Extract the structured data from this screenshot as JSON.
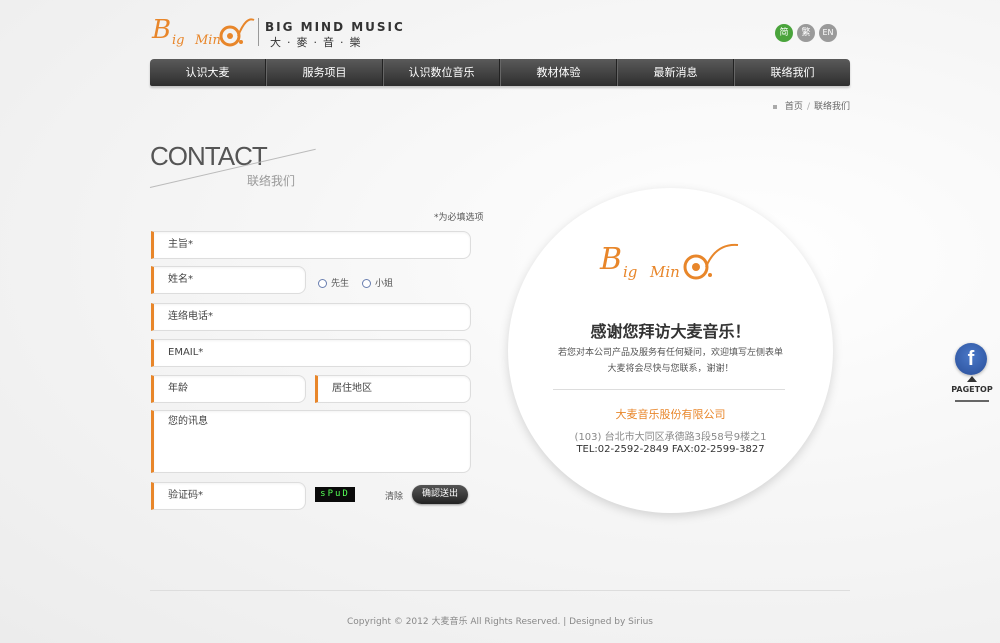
{
  "header": {
    "logo_text": "Big Mind",
    "brand_en": "BIG MIND MUSIC",
    "brand_cn": "大·麥·音·樂",
    "languages": [
      "简",
      "繁",
      "EN"
    ]
  },
  "nav": {
    "items": [
      "认识大麦",
      "服务项目",
      "认识数位音乐",
      "教材体验",
      "最新消息",
      "联络我们"
    ]
  },
  "breadcrumb": {
    "home": "首页",
    "separator": "/",
    "current": "联络我们"
  },
  "contact": {
    "title": "CONTACT",
    "subtitle": "联络我们",
    "required_note": "*为必填选项"
  },
  "form": {
    "subject_label": "主旨*",
    "name_label": "姓名*",
    "gender_options": [
      "先生",
      "小姐"
    ],
    "phone_label": "连络电话*",
    "email_label": "EMAIL*",
    "age_label": "年龄",
    "region_label": "居住地区",
    "message_label": "您的讯息",
    "captcha_label": "验证码*",
    "captcha_code": "sPuD",
    "clear_label": "清除",
    "submit_label": "确認送出"
  },
  "card": {
    "logo_text": "Big Mind",
    "thanks": "感谢您拜访大麦音乐！",
    "desc1": "若您对本公司产品及服务有任何疑问，欢迎填写左侧表单",
    "desc2": "大麦将会尽快与您联系，谢谢！",
    "company": "大麦音乐股份有限公司",
    "address": "(103) 台北市大同区承德路3段58号9楼之1",
    "phone": "TEL:02-2592-2849  FAX:02-2599-3827"
  },
  "widgets": {
    "facebook": "f",
    "pagetop": "PAGETOP"
  },
  "footer": {
    "copyright": "Copyright © 2012 大麦音乐 All Rights Reserved. | Designed by Sirius"
  },
  "colors": {
    "accent": "#e8862a",
    "nav_bg": "#3a3a3a",
    "lang_active": "#4aa43c"
  }
}
